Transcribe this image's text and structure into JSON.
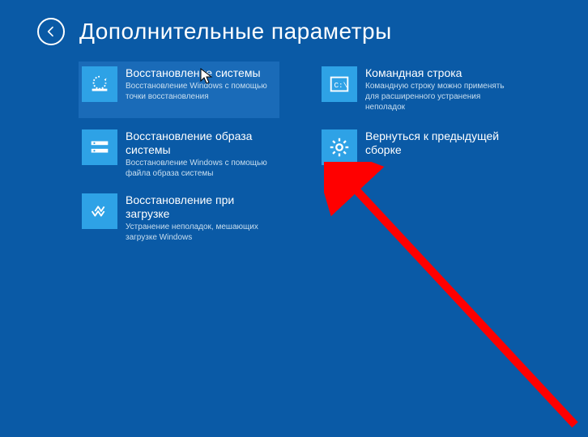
{
  "header": {
    "title": "Дополнительные параметры"
  },
  "tiles": {
    "system_restore": {
      "title": "Восстановление системы",
      "desc": "Восстановление Windows с помощью точки восстановления"
    },
    "image_recovery": {
      "title": "Восстановление образа системы",
      "desc": "Восстановление Windows с помощью файла образа системы"
    },
    "startup_repair": {
      "title": "Восстановление при загрузке",
      "desc": "Устранение неполадок, мешающих загрузке Windows"
    },
    "command_prompt": {
      "title": "Командная строка",
      "desc": "Командную строку можно применять для расширенного устранения неполадок"
    },
    "previous_build": {
      "title": "Вернуться к предыдущей сборке",
      "desc": ""
    }
  },
  "annotation": {
    "arrow_color": "#ff0000"
  }
}
